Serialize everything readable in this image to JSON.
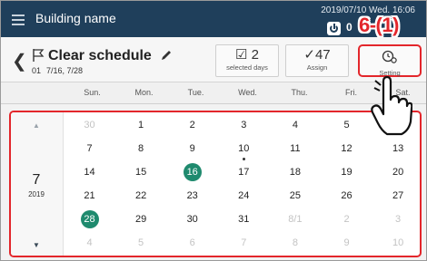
{
  "appbar": {
    "building": "Building name",
    "datetime": "2019/07/10 Wed. 16:06",
    "power_count": "0",
    "callout": "6-(1)"
  },
  "header": {
    "title": "Clear schedule",
    "schedule_number": "01",
    "dates": "7/16, 7/28",
    "selected_days_count": "2",
    "selected_days_label": "selected days",
    "assign_count": "47",
    "assign_label": "Assign",
    "setting_label": "Setting"
  },
  "weekdays": [
    "Sun.",
    "Mon.",
    "Tue.",
    "Wed.",
    "Thu.",
    "Fri.",
    "Sat."
  ],
  "calendar": {
    "month": "7",
    "year": "2019",
    "weeks": [
      [
        "30",
        "1",
        "2",
        "3",
        "4",
        "5",
        "6"
      ],
      [
        "7",
        "8",
        "9",
        "10",
        "11",
        "12",
        "13"
      ],
      [
        "14",
        "15",
        "16",
        "17",
        "18",
        "19",
        "20"
      ],
      [
        "21",
        "22",
        "23",
        "24",
        "25",
        "26",
        "27"
      ],
      [
        "28",
        "29",
        "30",
        "31",
        "8/1",
        "2",
        "3"
      ],
      [
        "4",
        "5",
        "6",
        "7",
        "8",
        "9",
        "10"
      ]
    ],
    "muted": [
      [
        0,
        0
      ],
      [
        4,
        4
      ],
      [
        4,
        5
      ],
      [
        4,
        6
      ],
      [
        5,
        0
      ],
      [
        5,
        1
      ],
      [
        5,
        2
      ],
      [
        5,
        3
      ],
      [
        5,
        4
      ],
      [
        5,
        5
      ],
      [
        5,
        6
      ]
    ],
    "selected": [
      [
        2,
        2
      ],
      [
        4,
        0
      ]
    ],
    "dotted": [
      [
        1,
        3
      ]
    ]
  },
  "colors": {
    "appbar": "#1f3f5b",
    "accent_red": "#e3262b",
    "selected_green": "#1f8a6e"
  }
}
